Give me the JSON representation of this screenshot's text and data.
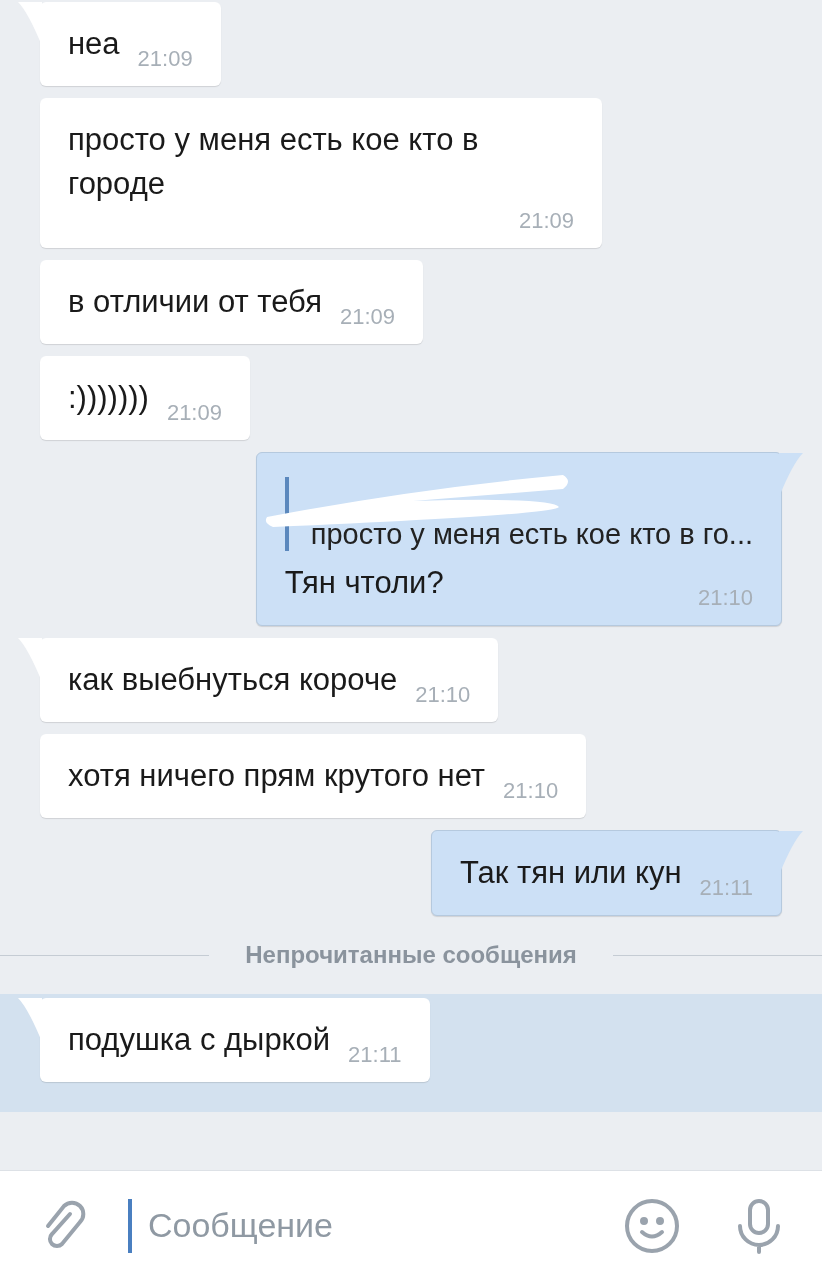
{
  "messages": [
    {
      "kind": "message",
      "outgoing": false,
      "tail": true,
      "unread": false,
      "text": "неа",
      "time": "21:09"
    },
    {
      "kind": "message",
      "outgoing": false,
      "tail": false,
      "unread": false,
      "text": "просто у меня есть кое кто в городе",
      "time": "21:09"
    },
    {
      "kind": "message",
      "outgoing": false,
      "tail": false,
      "unread": false,
      "text": "в отличии от тебя",
      "time": "21:09"
    },
    {
      "kind": "message",
      "outgoing": false,
      "tail": false,
      "unread": false,
      "text": ":)))))))",
      "time": "21:09"
    },
    {
      "kind": "message",
      "outgoing": true,
      "tail": true,
      "unread": false,
      "reply": {
        "text": "просто у меня есть кое кто в го..."
      },
      "text": "Тян чтоли?",
      "time": "21:10"
    },
    {
      "kind": "message",
      "outgoing": false,
      "tail": true,
      "unread": false,
      "text": "как выебнуться короче",
      "time": "21:10"
    },
    {
      "kind": "message",
      "outgoing": false,
      "tail": false,
      "unread": false,
      "text": "хотя ничего прям крутого нет",
      "time": "21:10"
    },
    {
      "kind": "message",
      "outgoing": true,
      "tail": true,
      "unread": false,
      "text": "Так тян или кун",
      "time": "21:11"
    },
    {
      "kind": "divider",
      "text": "Непрочитанные сообщения"
    },
    {
      "kind": "message",
      "outgoing": false,
      "tail": true,
      "unread": true,
      "text": "подушка с дыркой",
      "time": "21:11"
    }
  ],
  "composer": {
    "placeholder": "Сообщение"
  }
}
